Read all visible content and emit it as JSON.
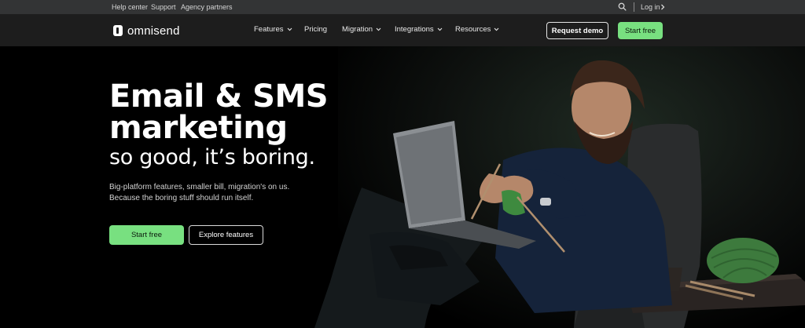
{
  "topbar": {
    "links": [
      "Help center",
      "Support",
      "Agency partners"
    ],
    "login": "Log in",
    "icons": {
      "search": "search-icon",
      "login_chevron": "chevron-right-icon"
    }
  },
  "nav": {
    "logo_text": "omnisend",
    "items": [
      {
        "label": "Features",
        "dropdown": true
      },
      {
        "label": "Pricing",
        "dropdown": false
      },
      {
        "label": "Migration",
        "dropdown": true
      },
      {
        "label": "Integrations",
        "dropdown": true
      },
      {
        "label": "Resources",
        "dropdown": true
      }
    ],
    "request_demo": "Request demo",
    "start_free": "Start free"
  },
  "hero": {
    "headline_line1": "Email & SMS",
    "headline_line2": "marketing",
    "subheadline": "so good, it’s boring.",
    "description_line1": "Big-platform features, smaller bill, migration's on us.",
    "description_line2": "Because the boring stuff should run itself.",
    "cta_primary": "Start free",
    "cta_secondary": "Explore features"
  },
  "colors": {
    "accent_green": "#78e080",
    "topbar_bg": "#333435",
    "nav_bg": "#1d1d1d",
    "hero_bg": "#000000"
  }
}
